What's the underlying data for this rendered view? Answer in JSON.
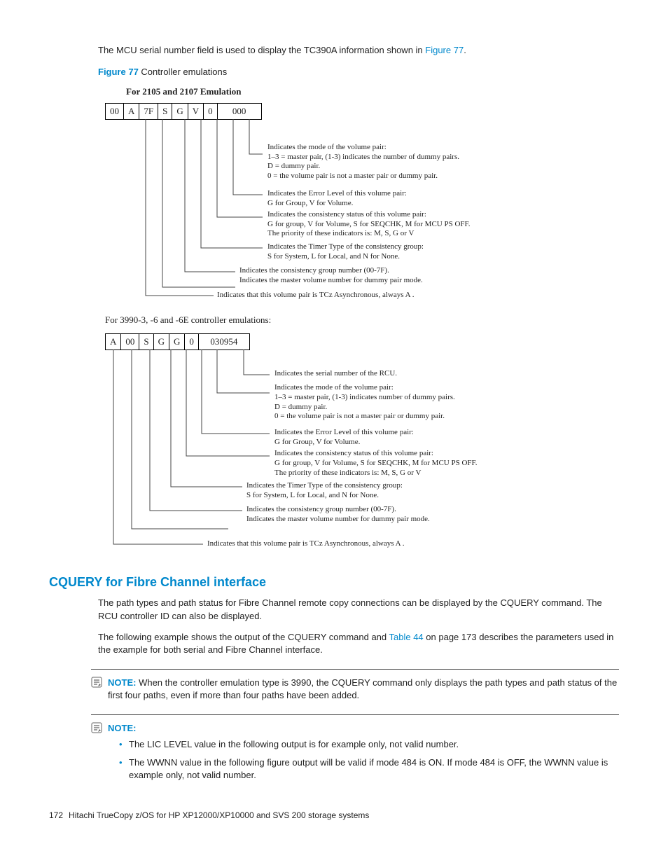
{
  "intro": {
    "pre": "The MCU serial number field is used to display the TC390A information shown in ",
    "link": "Figure 77",
    "post": "."
  },
  "figure": {
    "num": "Figure 77",
    "caption": "Controller emulations"
  },
  "diag1": {
    "title": "For 2105 and 2107 Emulation",
    "cells": [
      "00",
      "A",
      "7F",
      "S",
      "G",
      "V",
      "0",
      "000"
    ],
    "callouts": [
      "Indicates the mode of the volume pair:\n1–3 = master pair, (1-3) indicates the number of dummy pairs.\nD = dummy pair.\n0 = the volume pair is not a master pair or dummy pair.",
      "Indicates the Error Level of this volume pair:\nG for Group, V for Volume.",
      "Indicates the consistency status of this volume pair:\nG for group, V for Volume, S for SEQCHK, M for MCU PS OFF.\nThe priority of these indicators is: M, S, G or V",
      "Indicates the Timer Type of the consistency group:\nS for System, L for Local, and N for None.",
      "Indicates the consistency group number (00-7F).\nIndicates the master volume number for dummy pair mode.",
      "Indicates that this volume pair is TCz Asynchronous, always A ."
    ]
  },
  "diag2": {
    "title": "For 3990-3, -6 and -6E controller emulations:",
    "cells": [
      "A",
      "00",
      "S",
      "G",
      "G",
      "0",
      "030954"
    ],
    "callouts": [
      "Indicates the serial number of the RCU.",
      "Indicates the mode of the volume pair:\n1–3 = master pair, (1-3) indicates number of dummy pairs.\nD = dummy pair.\n0 = the volume pair is not a master pair or dummy pair.",
      "Indicates the Error Level of this volume pair:\nG for Group, V for Volume.",
      "Indicates the consistency status of this volume pair:\nG for group, V for Volume, S for SEQCHK, M for MCU PS OFF.\nThe priority of these indicators is: M, S, G or V",
      "Indicates the Timer Type of the consistency group:\nS for System, L for Local, and N for None.",
      "Indicates the consistency group number (00-7F).\nIndicates the master volume number for dummy pair mode.",
      "Indicates that this volume pair is TCz Asynchronous, always A ."
    ]
  },
  "section": {
    "heading": "CQUERY for Fibre Channel interface",
    "p1": "The path types and path status for Fibre Channel remote copy connections can be displayed by the CQUERY command. The RCU controller ID can also be displayed.",
    "p2_pre": "The following example shows the output of the CQUERY command and ",
    "p2_link": "Table 44",
    "p2_post": " on page 173 describes the parameters used in the example for both serial and Fibre Channel interface."
  },
  "note1": {
    "label": "NOTE:",
    "text": "When the controller emulation type is 3990, the CQUERY command only displays the path types and path status of the first four paths, even if more than four paths have been added."
  },
  "note2": {
    "label": "NOTE:",
    "b1": "The LIC LEVEL value in the following output is for example only, not valid number.",
    "b2": "The WWNN value in the following figure output will be valid if mode 484 is ON. If mode 484 is OFF, the WWNN value is example only, not valid number."
  },
  "footer": {
    "page": "172",
    "title": "Hitachi TrueCopy z/OS for HP XP12000/XP10000 and SVS 200 storage systems"
  }
}
